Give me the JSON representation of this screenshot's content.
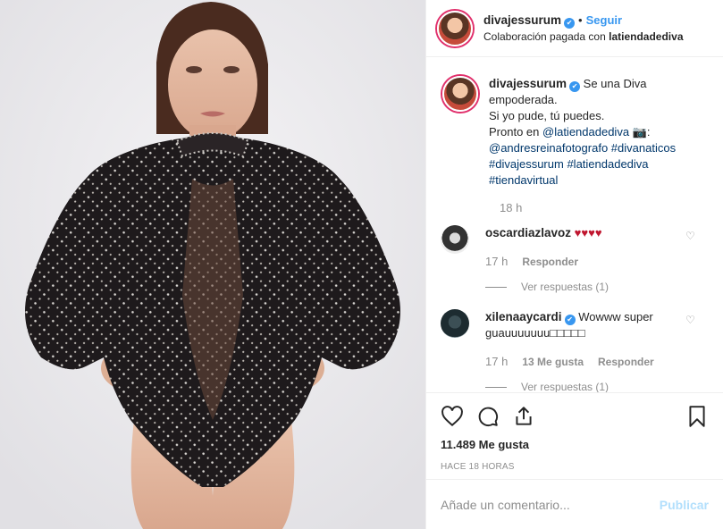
{
  "post": {
    "author": "divajessurum",
    "follow_label": "Seguir",
    "paid_prefix": "Colaboración pagada con",
    "paid_partner": "latiendadediva"
  },
  "caption": {
    "username": "divajessurum",
    "line1": "Se una Diva",
    "line2": "empoderada.",
    "line3": "Si yo pude, tú puedes.",
    "line4_prefix": "Pronto en",
    "line4_mention": "@latiendadediva",
    "line4_suffix": "📷:",
    "line5_mention": "@andresreinafotografo",
    "line5_tag": "#divanaticos",
    "line6_tag1": "#divajessurum",
    "line6_tag2": "#latiendadediva",
    "line7_tag": "#tiendavirtual",
    "time": "18 h"
  },
  "comments": [
    {
      "username": "oscardiazlavoz",
      "text": "♥♥♥♥",
      "time": "17 h",
      "likes": "",
      "reply_label": "Responder",
      "view_replies": "Ver respuestas (1)"
    },
    {
      "username": "xilenaaycardi",
      "text": "Wowww super guauuuuuuu□□□□□",
      "time": "17 h",
      "likes": "13 Me gusta",
      "reply_label": "Responder",
      "view_replies": "Ver respuestas (1)"
    }
  ],
  "actions": {
    "likes": "11.489 Me gusta",
    "ago": "HACE 18 HORAS"
  },
  "add_comment": {
    "placeholder": "Añade un comentario...",
    "publish": "Publicar"
  },
  "colors": {
    "accent": "#3897f0",
    "mention": "#00376b",
    "muted": "#8e8e8e",
    "publish_disabled": "#b2dffc"
  },
  "icons": [
    "heart-icon",
    "comment-icon",
    "share-icon",
    "bookmark-icon",
    "verified-icon",
    "like-comment-icon"
  ]
}
